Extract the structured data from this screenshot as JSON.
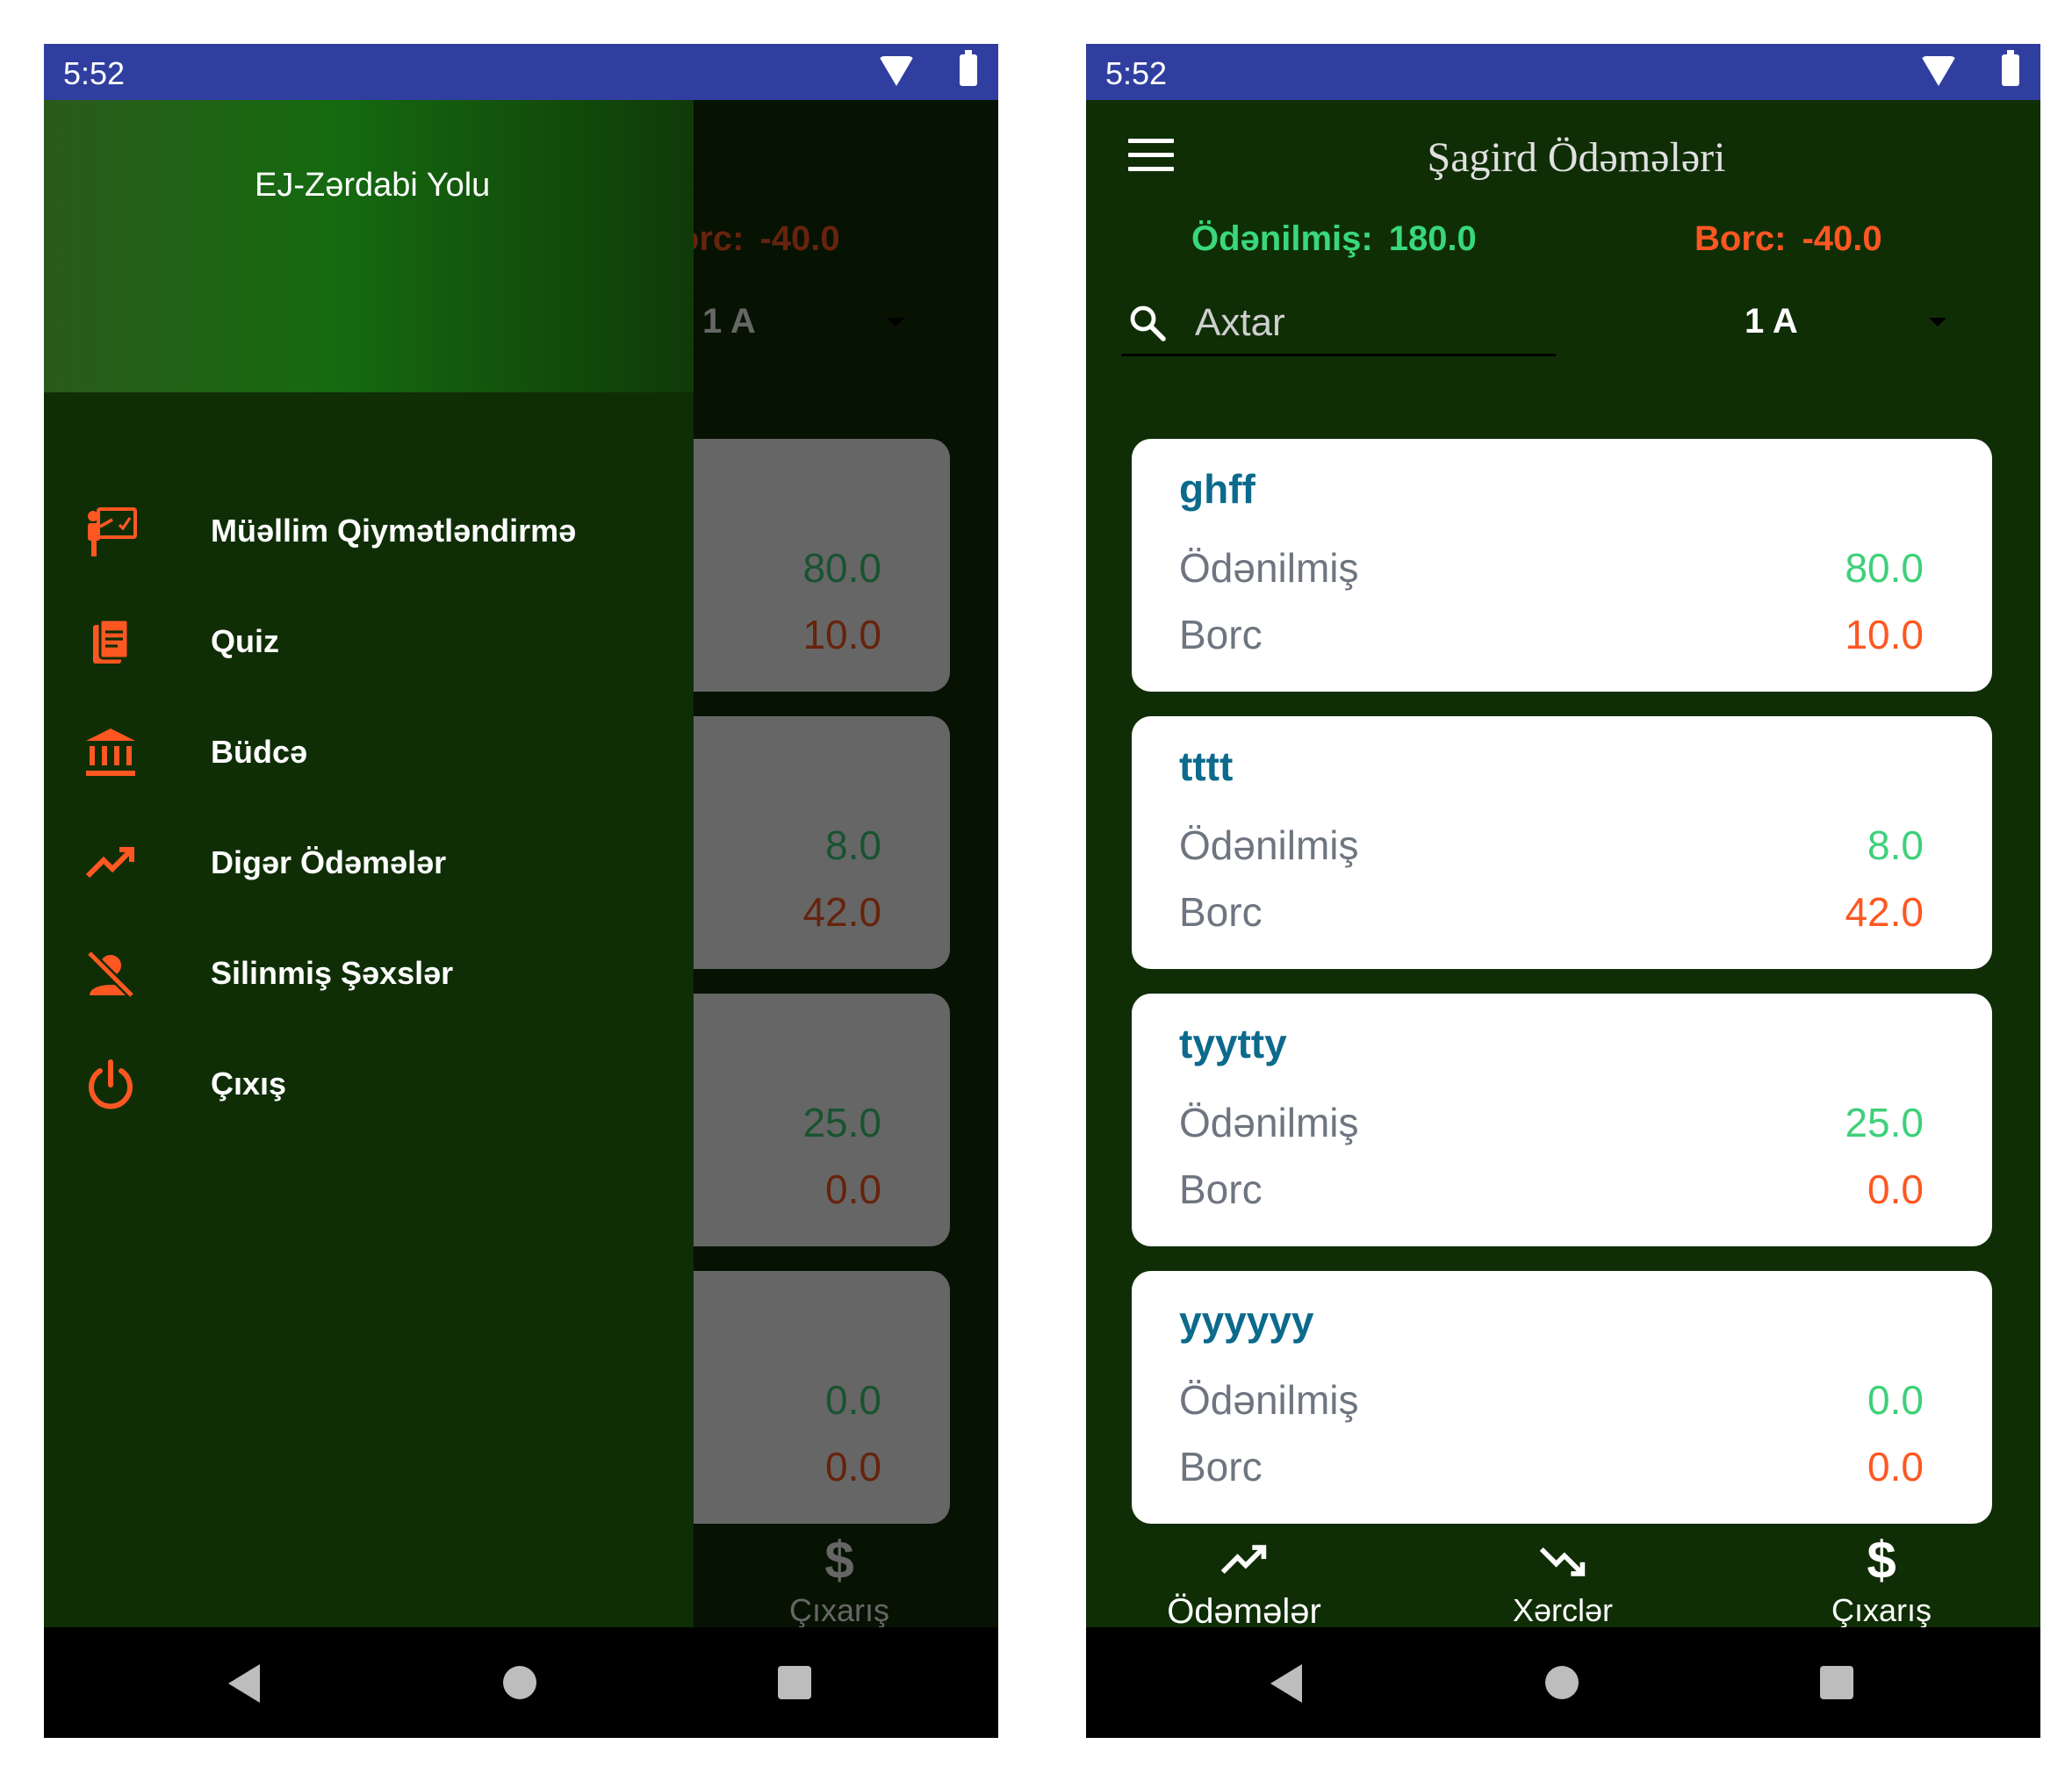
{
  "status_bar": {
    "time": "5:52"
  },
  "drawer": {
    "header_title": "EJ-Zərdabi Yolu",
    "items": [
      {
        "label": "Müəllim Qiymətləndirmə",
        "icon": "teacher-board-icon"
      },
      {
        "label": "Quiz",
        "icon": "document-copy-icon"
      },
      {
        "label": "Büdcə",
        "icon": "bank-icon"
      },
      {
        "label": "Digər Ödəmələr",
        "icon": "trending-up-icon"
      },
      {
        "label": "Silinmiş Şəxslər",
        "icon": "person-off-icon"
      },
      {
        "label": "Çıxış",
        "icon": "power-icon"
      }
    ]
  },
  "main": {
    "title": "Şagird Ödəmələri",
    "summary": {
      "paid_label": "Ödənilmiş:",
      "paid_value": "180.0",
      "debt_label": "Borc:",
      "debt_value": "-40.0",
      "debt_label_partial": "rc:"
    },
    "search": {
      "placeholder": "Axtar"
    },
    "class_select": {
      "value": "1 A"
    },
    "students": [
      {
        "name": "ghff",
        "paid_label": "Ödənilmiş",
        "paid": "80.0",
        "debt_label": "Borc",
        "debt": "10.0"
      },
      {
        "name": "tttt",
        "paid_label": "Ödənilmiş",
        "paid": "8.0",
        "debt_label": "Borc",
        "debt": "42.0"
      },
      {
        "name": "tyytty",
        "paid_label": "Ödənilmiş",
        "paid": "25.0",
        "debt_label": "Borc",
        "debt": "0.0"
      },
      {
        "name": "yyyyyy",
        "paid_label": "Ödənilmiş",
        "paid": "0.0",
        "debt_label": "Borc",
        "debt": "0.0"
      }
    ],
    "bottom_nav": [
      {
        "label": "Ödəmələr",
        "icon": "trending-up-icon",
        "active": true
      },
      {
        "label": "Xərclər",
        "icon": "trending-down-icon",
        "active": false
      },
      {
        "label": "Çıxarış",
        "icon": "dollar-icon",
        "active": false
      }
    ]
  },
  "colors": {
    "background": "#0f2e06",
    "status_bar": "#303f9f",
    "accent_orange": "#ff5722",
    "paid_green": "#39d87a",
    "student_name": "#0c6a8c"
  }
}
